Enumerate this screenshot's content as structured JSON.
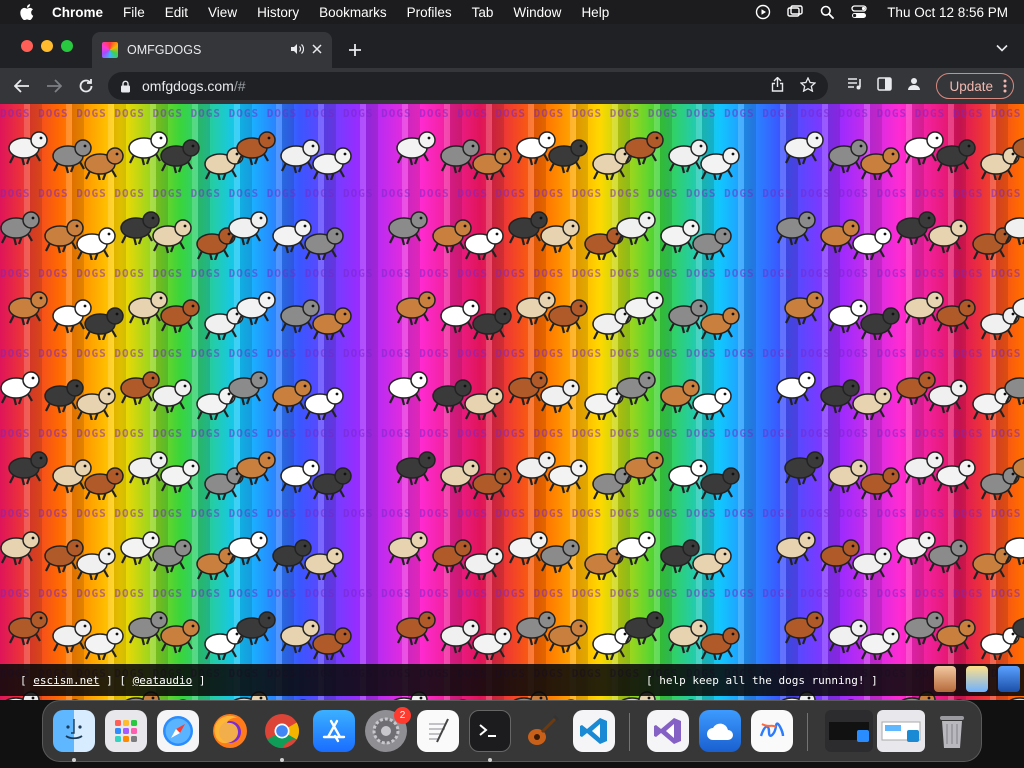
{
  "menubar": {
    "app_name": "Chrome",
    "items": [
      "File",
      "Edit",
      "View",
      "History",
      "Bookmarks",
      "Profiles",
      "Tab",
      "Window",
      "Help"
    ],
    "clock": "Thu Oct 12  8:56 PM"
  },
  "tab": {
    "title": "OMFGDOGS"
  },
  "address_bar": {
    "host": "omfgdogs.com",
    "path": "/#"
  },
  "toolbar": {
    "update_label": "Update"
  },
  "page": {
    "banner_word": "DOGS",
    "footer": {
      "link1": "escism.net",
      "link2": "@eataudio",
      "message": "[ help keep all the dogs running! ]"
    }
  },
  "dock": {
    "apps": [
      "Finder",
      "Launchpad",
      "Safari",
      "Firefox",
      "Chrome",
      "App Store",
      "System Settings",
      "TextEdit",
      "Terminal",
      "GarageBand",
      "Visual Studio Code",
      "Visual Studio",
      "Weather",
      "Freeform"
    ],
    "settings_badge": "2"
  },
  "colors": {
    "accent_update": "#d98a80",
    "tab_bg": "#35363a",
    "strip_bg": "#202124"
  }
}
